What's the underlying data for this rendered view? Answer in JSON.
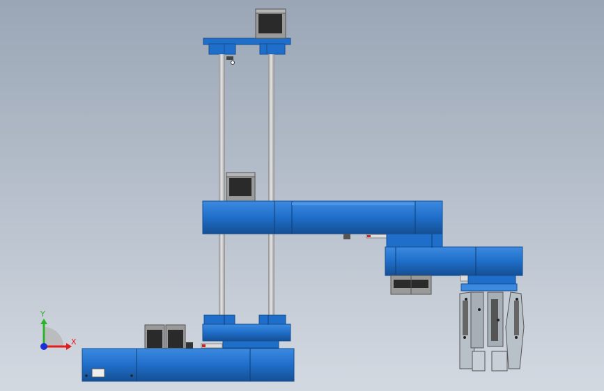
{
  "viewport": {
    "background_top": "#9aa6b6",
    "background_bottom": "#d3d9e1"
  },
  "colors": {
    "body_blue": "#1f6ec9",
    "body_blue_dark": "#154f93",
    "body_blue_light": "#3c8ae0",
    "rod": "#c9c9c9",
    "rod_dark": "#8f8f8f",
    "motor_dark": "#2a2a2a",
    "motor_gray": "#9a9a9a",
    "gripper": "#b8c0c8",
    "axis_x": "#e21b1b",
    "axis_y": "#2bb32b",
    "axis_z": "#1a2fd6"
  },
  "triad": {
    "x_label": "X",
    "y_label": "Y"
  }
}
